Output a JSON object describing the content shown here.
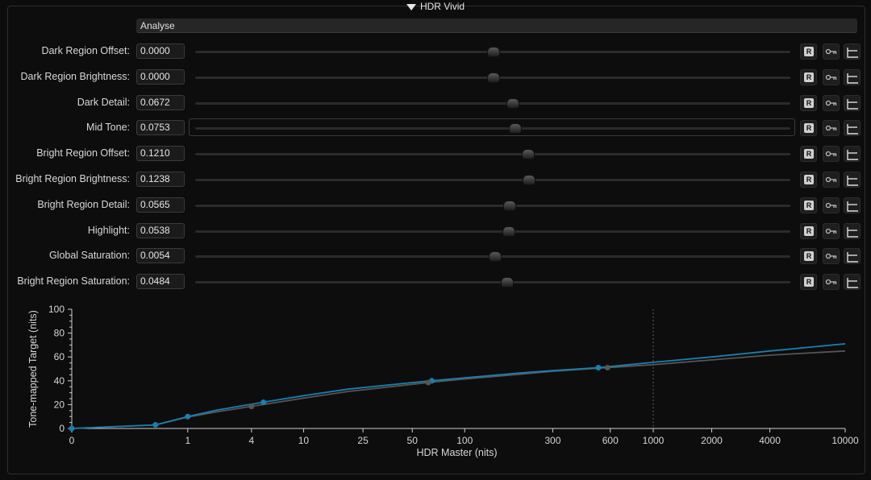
{
  "section": {
    "title": "HDR Vivid"
  },
  "analyse": {
    "label": "Analyse"
  },
  "rows": [
    {
      "label": "Dark Region Offset:",
      "value": "0.0000",
      "slider": 0.5
    },
    {
      "label": "Dark Region Brightness:",
      "value": "0.0000",
      "slider": 0.5
    },
    {
      "label": "Dark Detail:",
      "value": "0.0672",
      "slider": 0.532
    },
    {
      "label": "Mid Tone:",
      "value": "0.0753",
      "slider": 0.536
    },
    {
      "label": "Bright Region Offset:",
      "value": "0.1210",
      "slider": 0.558
    },
    {
      "label": "Bright Region Brightness:",
      "value": "0.1238",
      "slider": 0.56
    },
    {
      "label": "Bright Region Detail:",
      "value": "0.0565",
      "slider": 0.527
    },
    {
      "label": "Highlight:",
      "value": "0.0538",
      "slider": 0.526
    },
    {
      "label": "Global Saturation:",
      "value": "0.0054",
      "slider": 0.503
    },
    {
      "label": "Bright Region Saturation:",
      "value": "0.0484",
      "slider": 0.523
    }
  ],
  "buttons": {
    "reset_glyph": "R"
  },
  "chart_data": {
    "type": "line",
    "xlabel": "HDR Master (nits)",
    "ylabel": "Tone-mapped Target (nits)",
    "x_ticks": [
      "0",
      "1",
      "4",
      "10",
      "25",
      "50",
      "100",
      "300",
      "600",
      "1000",
      "2000",
      "4000",
      "10000"
    ],
    "y_ticks": [
      "0",
      "20",
      "40",
      "60",
      "80",
      "100"
    ],
    "ylim": [
      0,
      100
    ],
    "x_scale": "pq",
    "reference_line_x": 1000,
    "series": [
      {
        "color": "#1a7fb0",
        "x": [
          0,
          0.4,
          1,
          2,
          5,
          10,
          20,
          50,
          65,
          100,
          200,
          300,
          520,
          1000,
          2000,
          4000,
          10000
        ],
        "y": [
          0,
          3,
          10,
          15.5,
          22,
          27.5,
          33,
          38.5,
          40,
          42.5,
          46.5,
          48.5,
          51,
          55.5,
          60,
          65,
          71
        ]
      },
      {
        "color": "#555555",
        "x": [
          0,
          0.4,
          1,
          2,
          4,
          10,
          20,
          50,
          62,
          100,
          200,
          300,
          580,
          1000,
          2000,
          4000,
          10000
        ],
        "y": [
          0,
          3,
          9.5,
          14,
          18.5,
          25.5,
          31,
          37,
          38.5,
          41.5,
          45.5,
          48,
          51,
          53.5,
          57.5,
          61.5,
          65
        ]
      }
    ],
    "markers": [
      {
        "color": "#1a7fb0",
        "x": [
          0,
          0.4,
          1,
          5,
          65,
          520
        ],
        "y": [
          0,
          3,
          10,
          22,
          40,
          51
        ]
      },
      {
        "color": "#555555",
        "x": [
          4,
          62,
          580
        ],
        "y": [
          18.5,
          38.5,
          51
        ]
      }
    ]
  }
}
